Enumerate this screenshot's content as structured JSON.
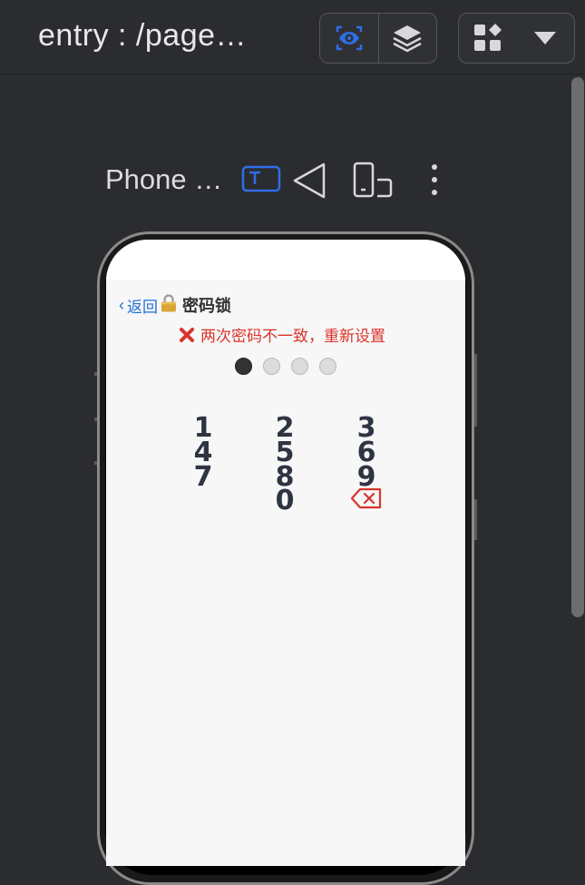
{
  "header": {
    "title": "entry : /page…",
    "icons": {
      "inspect": "eye-scan-icon",
      "layers": "layers-icon",
      "widgets": "widgets-icon",
      "dropdown": "caret-down-icon"
    }
  },
  "device_toolbar": {
    "device_name": "Phone …",
    "icons": [
      "text-box-icon",
      "triangle-back-icon",
      "device-rotate-icon",
      "more-vertical-icon"
    ]
  },
  "screen": {
    "back_label": "返回",
    "back_chevron": "‹",
    "title": "密码锁",
    "error_message": "两次密码不一致，重新设置",
    "pin_dots": [
      true,
      false,
      false,
      false
    ],
    "keypad": {
      "keys": [
        "1",
        "2",
        "3",
        "4",
        "5",
        "6",
        "7",
        "8",
        "9",
        "0"
      ],
      "delete_icon": "backspace-icon"
    }
  },
  "colors": {
    "accent": "#2f6ee6",
    "error": "#d9342b",
    "back_link": "#1f6fd6",
    "background": "#2b2c30"
  }
}
